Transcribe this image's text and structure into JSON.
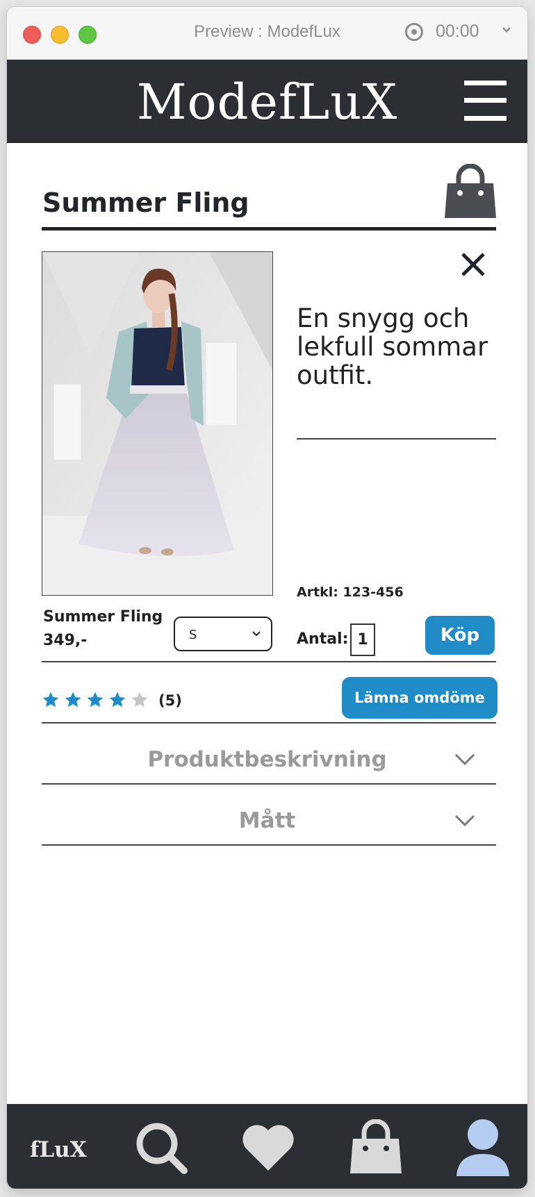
{
  "window": {
    "title": "Preview : ModefLux",
    "timer": "00:00"
  },
  "header": {
    "logo": "ModefLuX"
  },
  "product": {
    "page_title": "Summer Fling",
    "description": "En snygg och lekfull sommar outfit.",
    "article_number": "Artkl: 123-456",
    "name": "Summer Fling",
    "price": "349,-",
    "size_selected": "S",
    "quantity_label": "Antal:",
    "quantity": "1",
    "buy_label": "Köp",
    "rating": {
      "value": 4,
      "max": 5,
      "count_label": "(5)"
    },
    "review_button_label": "Lämna omdöme"
  },
  "accordion": [
    {
      "label": "Produktbeskrivning"
    },
    {
      "label": "Mått"
    }
  ],
  "bottom_nav": {
    "brand": "fLuX",
    "icons": [
      "search-icon",
      "heart-icon",
      "bag-icon",
      "profile-icon"
    ]
  },
  "colors": {
    "header_bg": "#2b2e32",
    "accent": "#1f8cc7",
    "star_filled": "#1f8cc7",
    "star_empty": "#c4c4c4",
    "nav_icon": "#d9d9d9",
    "profile_icon": "#b5cdf0"
  }
}
